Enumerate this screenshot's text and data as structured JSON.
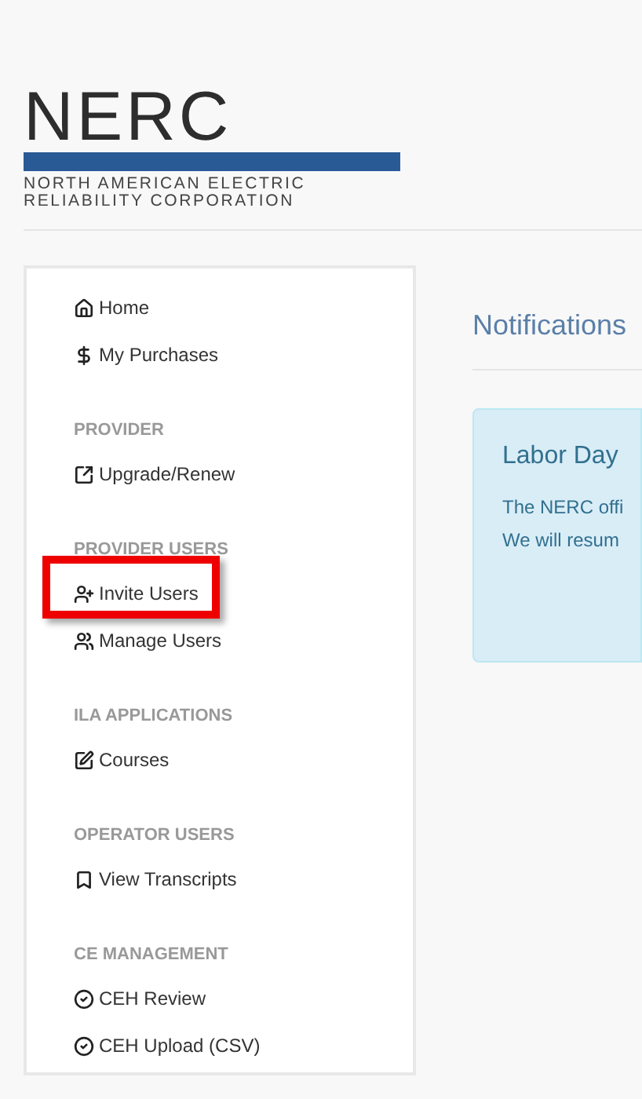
{
  "logo": {
    "wordmark": "NERC",
    "line_1": "NORTH AMERICAN ELECTRIC",
    "line_2": "RELIABILITY CORPORATION"
  },
  "sidebar": {
    "sections": [
      {
        "items": [
          {
            "label": "Home",
            "highlighted": false
          },
          {
            "label": "My Purchases",
            "highlighted": false
          }
        ]
      },
      {
        "heading": "PROVIDER",
        "items": [
          {
            "label": "Upgrade/Renew",
            "highlighted": false
          }
        ]
      },
      {
        "heading": "PROVIDER USERS",
        "items": [
          {
            "label": "Invite Users",
            "highlighted": true
          },
          {
            "label": "Manage Users",
            "highlighted": false
          }
        ]
      },
      {
        "heading": "ILA APPLICATIONS",
        "items": [
          {
            "label": "Courses",
            "highlighted": false
          }
        ]
      },
      {
        "heading": "OPERATOR USERS",
        "items": [
          {
            "label": "View Transcripts",
            "highlighted": false
          }
        ]
      },
      {
        "heading": "CE MANAGEMENT",
        "items": [
          {
            "label": "CEH Review",
            "highlighted": false
          },
          {
            "label": "CEH Upload (CSV)",
            "highlighted": false
          }
        ]
      }
    ]
  },
  "main": {
    "title": "Notifications",
    "alert": {
      "title": "Labor Day",
      "lines": [
        "The NERC offi",
        "We will resum"
      ]
    }
  }
}
